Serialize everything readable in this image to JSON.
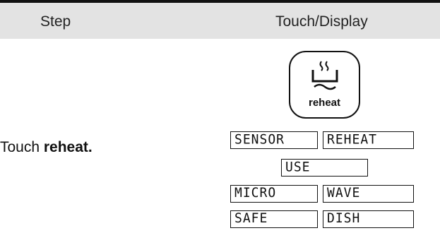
{
  "header": {
    "step_label": "Step",
    "touch_label": "Touch/Display"
  },
  "reheat_button": {
    "icon": "reheat-steam-bowl-icon",
    "label": "reheat"
  },
  "instruction": {
    "prefix": "Touch ",
    "emphasis": "reheat."
  },
  "display": {
    "row1_left": "SENSOR",
    "row1_right": "REHEAT",
    "row2_center": "USE",
    "row3_left": "MICRO",
    "row3_right": "WAVE",
    "row4_left": "SAFE",
    "row4_right": "DISH"
  }
}
